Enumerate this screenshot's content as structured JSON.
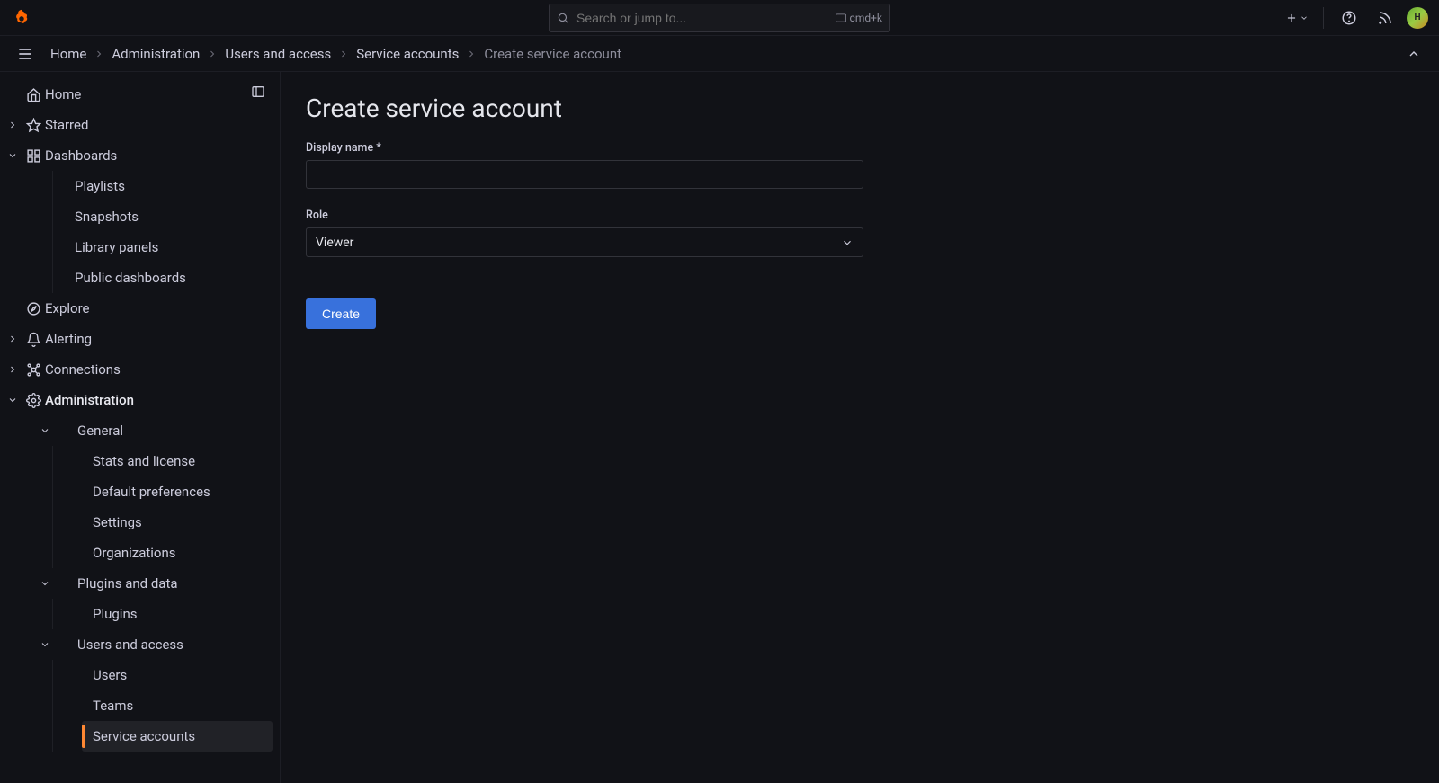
{
  "header": {
    "search_placeholder": "Search or jump to...",
    "shortcut": "cmd+k"
  },
  "breadcrumbs": {
    "items": [
      "Home",
      "Administration",
      "Users and access",
      "Service accounts",
      "Create service account"
    ]
  },
  "sidebar": {
    "home": "Home",
    "starred": "Starred",
    "dashboards": "Dashboards",
    "dashboards_children": [
      "Playlists",
      "Snapshots",
      "Library panels",
      "Public dashboards"
    ],
    "explore": "Explore",
    "alerting": "Alerting",
    "connections": "Connections",
    "administration": "Administration",
    "admin_general": "General",
    "admin_general_children": [
      "Stats and license",
      "Default preferences",
      "Settings",
      "Organizations"
    ],
    "admin_plugins": "Plugins and data",
    "admin_plugins_children": [
      "Plugins"
    ],
    "admin_users": "Users and access",
    "admin_users_children": [
      "Users",
      "Teams",
      "Service accounts"
    ]
  },
  "page": {
    "title": "Create service account",
    "display_name_label": "Display name *",
    "display_name_value": "",
    "role_label": "Role",
    "role_value": "Viewer",
    "submit_label": "Create"
  },
  "avatar_initial": "H"
}
